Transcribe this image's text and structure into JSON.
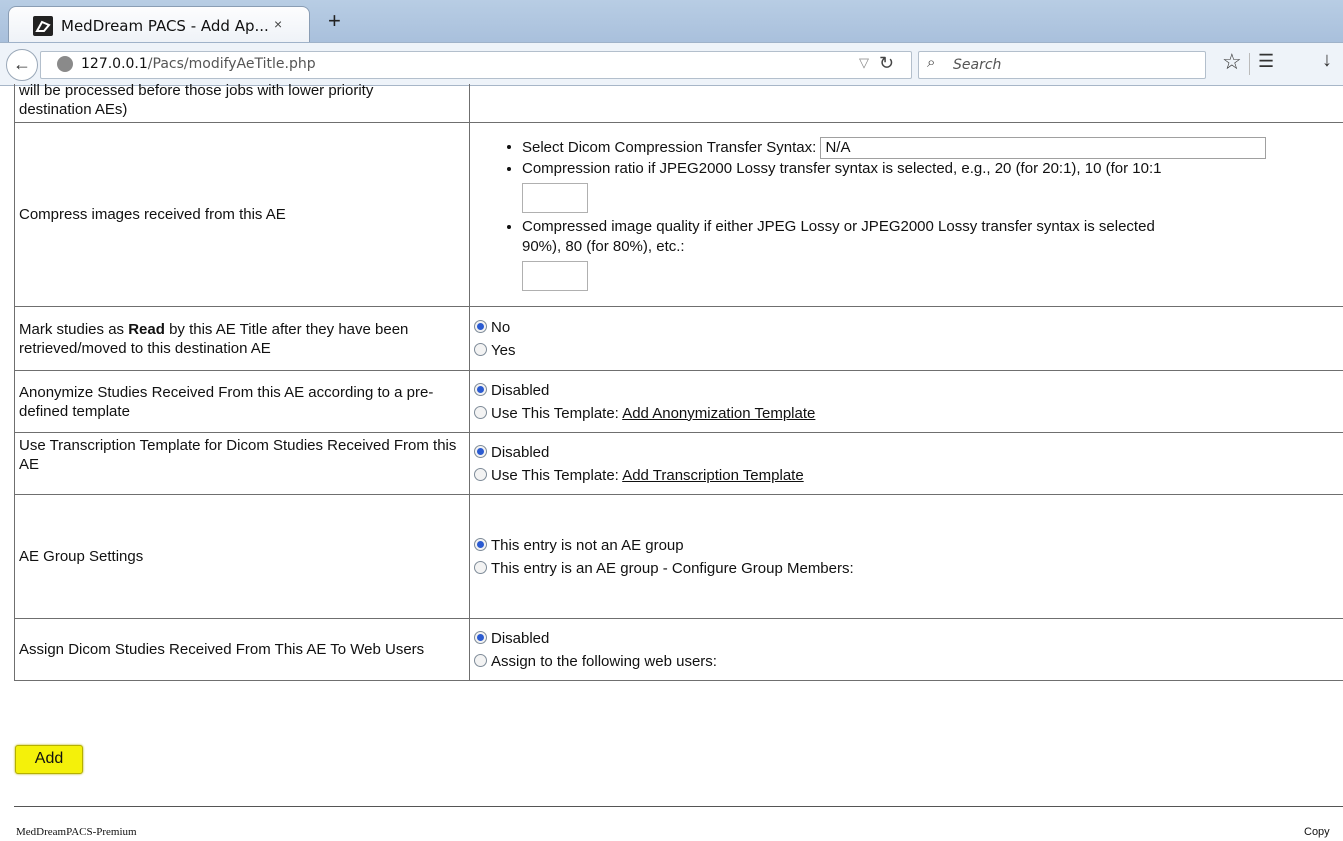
{
  "browser": {
    "tab_title": "MedDream PACS - Add Ap...",
    "tab_close": "×",
    "new_tab": "+",
    "url_host": "127.0.0.1",
    "url_path": "/Pacs/modifyAeTitle.php",
    "search_placeholder": "Search"
  },
  "rows": {
    "priority_label_line1": "will be processed before those jobs with lower priority",
    "priority_label_line2": "destination AEs)",
    "compress": {
      "label": "Compress images received from this AE",
      "syntax_label": "Select Dicom Compression Transfer Syntax:",
      "syntax_value": "N/A",
      "ratio_label": "Compression ratio if JPEG2000 Lossy transfer syntax is selected, e.g., 20 (for 20:1), 10 (for 10:1",
      "quality_label_line1": "Compressed image quality if either JPEG Lossy or JPEG2000 Lossy transfer syntax is selected",
      "quality_label_line2": "90%), 80 (for 80%), etc.:"
    },
    "mark_read": {
      "label_pre": "Mark studies as ",
      "label_bold": "Read",
      "label_post": " by this AE Title after they have been retrieved/moved to this destination AE",
      "opt_no": "No",
      "opt_yes": "Yes"
    },
    "anonymize": {
      "label": "Anonymize Studies Received From this AE according to a pre-defined template",
      "opt_disabled": "Disabled",
      "opt_use": "Use This Template: ",
      "link": "Add Anonymization Template"
    },
    "transcription": {
      "label": "Use Transcription Template for Dicom Studies Received From this AE",
      "opt_disabled": "Disabled",
      "opt_use": "Use This Template: ",
      "link": "Add Transcription Template"
    },
    "group": {
      "label": "AE Group Settings",
      "opt_not": "This entry is not an AE group",
      "opt_is": "This entry is an AE group - Configure Group Members:"
    },
    "assign": {
      "label": "Assign Dicom Studies Received From This AE To Web Users",
      "opt_disabled": "Disabled",
      "opt_assign": "Assign to the following web users:"
    }
  },
  "add_button": "Add",
  "footer": {
    "left": "MedDreamPACS-Premium",
    "right": "Copy"
  }
}
